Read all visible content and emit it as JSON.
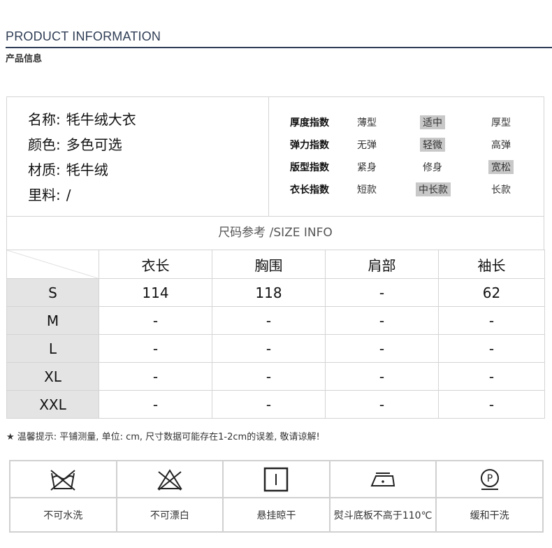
{
  "header": {
    "title_en": "PRODUCT INFORMATION",
    "title_zh": "产品信息"
  },
  "product": {
    "properties": [
      {
        "key": "名称:",
        "value": "牦牛绒大衣"
      },
      {
        "key": "颜色:",
        "value": "多色可选"
      },
      {
        "key": "材质:",
        "value": "牦牛绒"
      },
      {
        "key": "里料:",
        "value": "/"
      }
    ],
    "indices": [
      {
        "label": "厚度指数",
        "options": [
          "薄型",
          "适中",
          "厚型"
        ],
        "selected": "适中"
      },
      {
        "label": "弹力指数",
        "options": [
          "无弹",
          "轻微",
          "高弹"
        ],
        "selected": "轻微"
      },
      {
        "label": "版型指数",
        "options": [
          "紧身",
          "修身",
          "宽松"
        ],
        "selected": "宽松"
      },
      {
        "label": "衣长指数",
        "options": [
          "短款",
          "中长款",
          "长款"
        ],
        "selected": "中长款"
      }
    ]
  },
  "size_table": {
    "title": "尺码参考 /SIZE INFO",
    "columns": [
      "衣长",
      "胸围",
      "肩部",
      "袖长"
    ],
    "rows": [
      {
        "size": "S",
        "values": [
          "114",
          "118",
          "-",
          "62"
        ]
      },
      {
        "size": "M",
        "values": [
          "-",
          "-",
          "-",
          "-"
        ]
      },
      {
        "size": "L",
        "values": [
          "-",
          "-",
          "-",
          "-"
        ]
      },
      {
        "size": "XL",
        "values": [
          "-",
          "-",
          "-",
          "-"
        ]
      },
      {
        "size": "XXL",
        "values": [
          "-",
          "-",
          "-",
          "-"
        ]
      }
    ]
  },
  "tip": "★ 温馨提示: 平铺测量, 单位: cm, 尺寸数据可能存在1-2cm的误差, 敬请谅解!",
  "care": [
    {
      "icon": "no-wash-icon",
      "label": "不可水洗"
    },
    {
      "icon": "no-bleach-icon",
      "label": "不可漂白"
    },
    {
      "icon": "hang-dry-icon",
      "label": "悬挂晾干"
    },
    {
      "icon": "iron-low-icon",
      "label": "熨斗底板不高于110℃"
    },
    {
      "icon": "dry-clean-p-icon",
      "label": "缓和干洗"
    }
  ],
  "colors": {
    "header_accent": "#2f3e56",
    "selected_bg": "#c8c8c8",
    "row_header_bg": "#e4e4e4",
    "border": "#d4d4d4"
  }
}
